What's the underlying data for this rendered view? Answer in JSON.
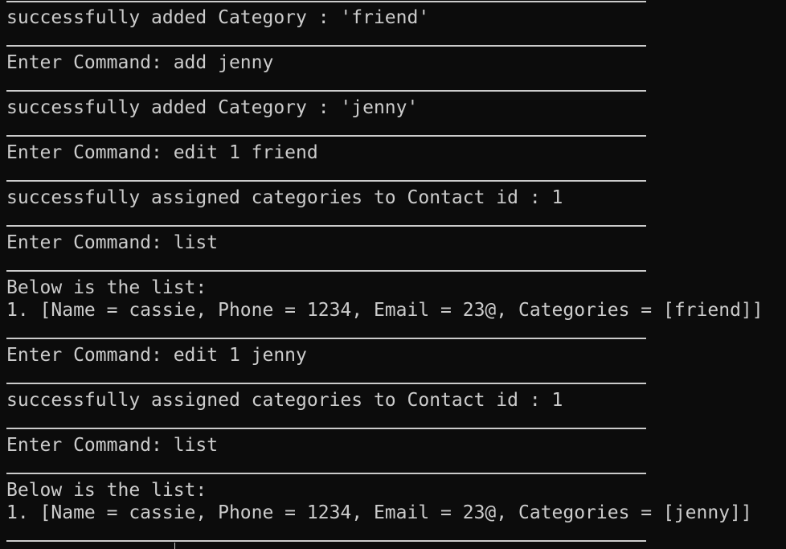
{
  "terminal": {
    "lines": [
      "successfully added Category : 'friend'",
      "Enter Command: add jenny",
      "successfully added Category : 'jenny'",
      "Enter Command: edit 1 friend",
      "successfully assigned categories to Contact id : 1",
      "Enter Command: list",
      "Below is the list:",
      "1. [Name = cassie, Phone = 1234, Email = 23@, Categories = [friend]]",
      "Enter Command: edit 1 jenny",
      "successfully assigned categories to Contact id : 1",
      "Enter Command: list",
      "Below is the list:",
      "1. [Name = cassie, Phone = 1234, Email = 23@, Categories = [jenny]]"
    ]
  }
}
